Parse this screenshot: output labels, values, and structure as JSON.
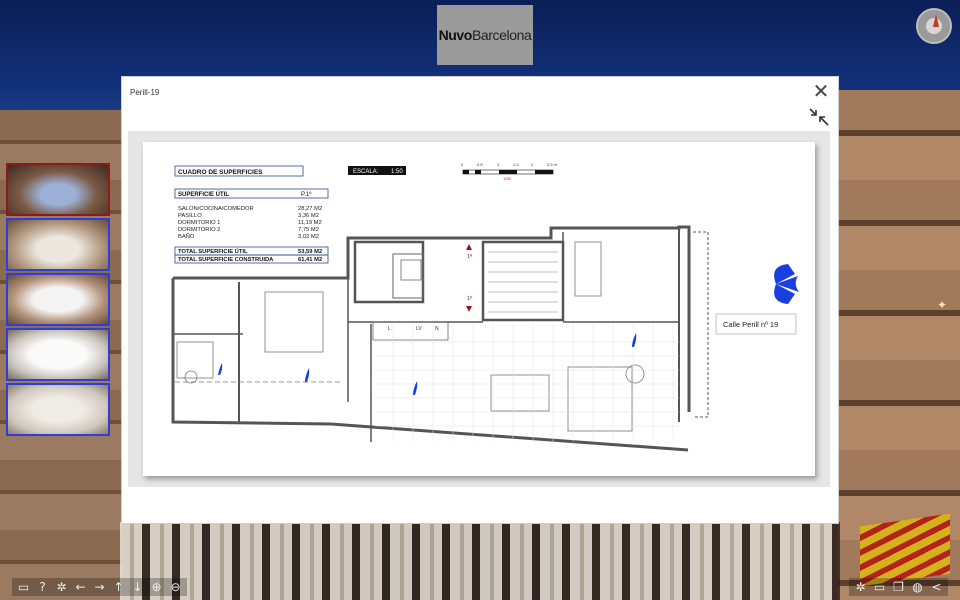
{
  "logo": {
    "part1": "Nuvo",
    "part2": "Barcelona"
  },
  "modal": {
    "title": "Perill-19",
    "close_icon": "close-icon",
    "fit_icon": "collapse-arrows-icon"
  },
  "floorplan": {
    "superficies_title": "CUADRO DE SUPERFICIES",
    "escala_label": "ESCALA:",
    "escala_value": "1:50",
    "scale_ticks": [
      "0",
      "0.5",
      "1",
      "1.5",
      "2",
      "2.5 m"
    ],
    "scale_unit": "1/50",
    "util_label": "SUPERFICIE ÚTIL",
    "util_column": "P.1º",
    "rooms": [
      {
        "name": "SALON/COCINA/COMEDOR",
        "area": "28,27 M2"
      },
      {
        "name": "PASILLO",
        "area": "3,36 M2"
      },
      {
        "name": "DORMITORIO 1",
        "area": "11,19 M2"
      },
      {
        "name": "DORMITORIO 2",
        "area": "7,75 M2"
      },
      {
        "name": "BAÑO",
        "area": "3,02 M2"
      }
    ],
    "total_util_label": "TOTAL SUPERFICIE ÚTIL",
    "total_util_value": "53,59 M2",
    "total_constr_label": "TOTAL SUPERFICIE CONSTRUIDA",
    "total_constr_value": "61,41 M2",
    "street_label": "Calle Perill nº 19",
    "stair_up": "1ª",
    "stair_down": "1º",
    "appliance_labels": [
      "L",
      "LV",
      "N"
    ],
    "marker_color": "#1a3fe0",
    "wall_color": "#555555"
  },
  "thumbnails": [
    {
      "name": "thumbnail-exterior",
      "active": true
    },
    {
      "name": "thumbnail-room-2"
    },
    {
      "name": "thumbnail-room-3"
    },
    {
      "name": "thumbnail-room-4"
    },
    {
      "name": "thumbnail-room-5"
    }
  ],
  "toolbar_left": [
    {
      "name": "fullscreen-window-icon",
      "glyph": "▭"
    },
    {
      "name": "help-icon",
      "glyph": "?"
    },
    {
      "name": "autorotate-icon",
      "glyph": "✲"
    },
    {
      "name": "arrow-left-icon",
      "glyph": "←"
    },
    {
      "name": "arrow-right-icon",
      "glyph": "→"
    },
    {
      "name": "arrow-up-icon",
      "glyph": "↑"
    },
    {
      "name": "arrow-down-icon",
      "glyph": "↓"
    },
    {
      "name": "zoom-in-icon",
      "glyph": "⊕"
    },
    {
      "name": "zoom-out-icon",
      "glyph": "⊖"
    }
  ],
  "toolbar_right": [
    {
      "name": "gyroscope-icon",
      "glyph": "✲"
    },
    {
      "name": "screen-icon",
      "glyph": "▭"
    },
    {
      "name": "copy-icon",
      "glyph": "❐"
    },
    {
      "name": "globe-icon",
      "glyph": "◍"
    },
    {
      "name": "share-icon",
      "glyph": "<"
    }
  ],
  "colors": {
    "thumb_border": "#2e3fd6",
    "thumb_active_border": "#8e1a1a",
    "accent_red": "#8e1a1a"
  }
}
